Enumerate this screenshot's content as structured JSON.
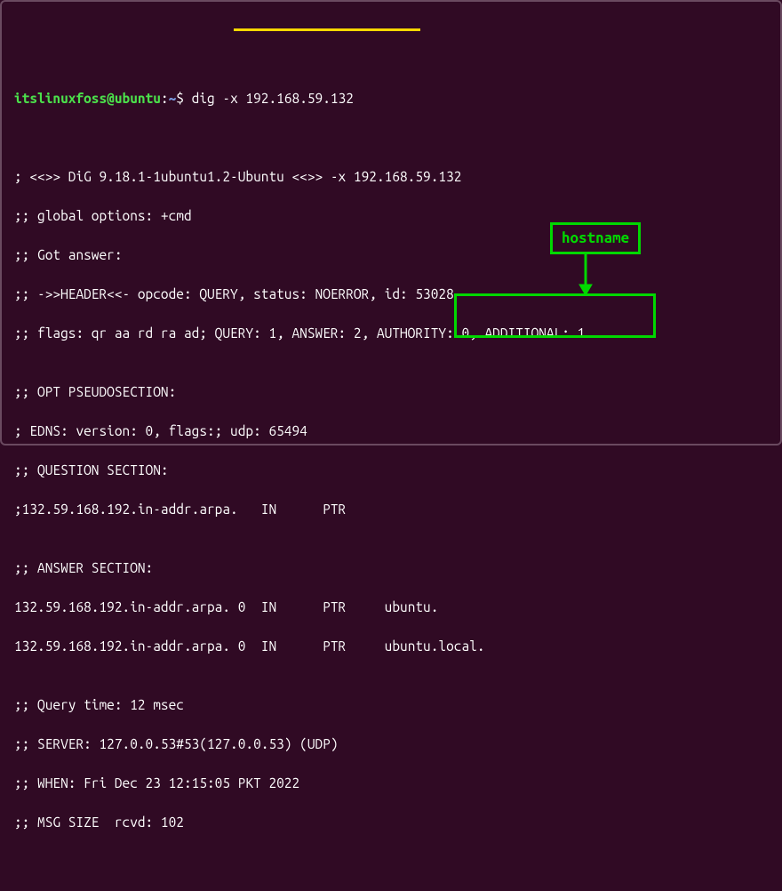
{
  "prompt": {
    "user": "itslinuxfoss@ubuntu",
    "sep": ":",
    "path": "~",
    "dollar": "$"
  },
  "command": "dig -x 192.168.59.132",
  "output": {
    "l0": "",
    "l1": "; <<>> DiG 9.18.1-1ubuntu1.2-Ubuntu <<>> -x 192.168.59.132",
    "l2": ";; global options: +cmd",
    "l3": ";; Got answer:",
    "l4": ";; ->>HEADER<<- opcode: QUERY, status: NOERROR, id: 53028",
    "l5": ";; flags: qr aa rd ra ad; QUERY: 1, ANSWER: 2, AUTHORITY: 0, ADDITIONAL: 1",
    "l6": "",
    "l7": ";; OPT PSEUDOSECTION:",
    "l8": "; EDNS: version: 0, flags:; udp: 65494",
    "l9": ";; QUESTION SECTION:",
    "l10": ";132.59.168.192.in-addr.arpa.   IN      PTR",
    "l11": "",
    "l12": ";; ANSWER SECTION:",
    "l13a": "132.59.168.192.in-addr.arpa. 0  IN      PTR     ",
    "l13b": "ubuntu.",
    "l14a": "132.59.168.192.in-addr.arpa. 0  IN      PTR     ",
    "l14b": "ubuntu.local.",
    "l15": "",
    "l16": ";; Query time: 12 msec",
    "l17": ";; SERVER: 127.0.0.53#53(127.0.0.53) (UDP)",
    "l18": ";; WHEN: Fri Dec 23 12:15:05 PKT 2022",
    "l19": ";; MSG SIZE  rcvd: 102"
  },
  "annotations": {
    "hostname_label": "hostname"
  }
}
